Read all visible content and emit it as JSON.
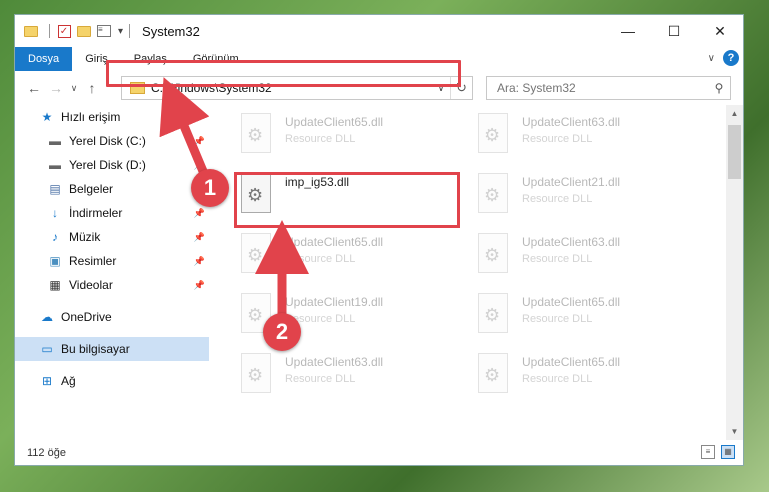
{
  "window": {
    "title": "System32",
    "controls": {
      "minimize": "—",
      "maximize": "☐",
      "close": "✕"
    }
  },
  "ribbon": {
    "tabs": [
      {
        "label": "Dosya",
        "active": true
      },
      {
        "label": "Giriş"
      },
      {
        "label": "Paylaş"
      },
      {
        "label": "Görünüm"
      }
    ],
    "help": "?"
  },
  "address": {
    "path": "C:\\Windows\\System32",
    "search_placeholder": "Ara: System32"
  },
  "sidebar": {
    "items": [
      {
        "label": "Hızlı erişim",
        "icon": "star-icon"
      },
      {
        "label": "Yerel Disk (C:)",
        "icon": "drive-icon",
        "pinned": true
      },
      {
        "label": "Yerel Disk (D:)",
        "icon": "drive-icon",
        "pinned": true
      },
      {
        "label": "Belgeler",
        "icon": "documents-icon",
        "pinned": true
      },
      {
        "label": "İndirmeler",
        "icon": "download-icon",
        "pinned": true
      },
      {
        "label": "Müzik",
        "icon": "music-icon",
        "pinned": true
      },
      {
        "label": "Resimler",
        "icon": "pictures-icon",
        "pinned": true
      },
      {
        "label": "Videolar",
        "icon": "videos-icon",
        "pinned": true
      },
      {
        "label": "OneDrive",
        "icon": "cloud-icon"
      },
      {
        "label": "Bu bilgisayar",
        "icon": "computer-icon",
        "selected": true
      },
      {
        "label": "Ağ",
        "icon": "network-icon"
      }
    ]
  },
  "files": [
    {
      "name": "UpdateClient65.dll",
      "type": "Resource DLL",
      "faded": true
    },
    {
      "name": "UpdateClient63.dll",
      "type": "Resource DLL",
      "faded": true
    },
    {
      "name": "imp_ig53.dll",
      "type": "",
      "faded": false
    },
    {
      "name": "UpdateClient21.dll",
      "type": "Resource DLL",
      "faded": true
    },
    {
      "name": "UpdateClient65.dll",
      "type": "Resource DLL",
      "faded": true
    },
    {
      "name": "UpdateClient63.dll",
      "type": "Resource DLL",
      "faded": true
    },
    {
      "name": "UpdateClient19.dll",
      "type": "Resource DLL",
      "faded": true
    },
    {
      "name": "UpdateClient65.dll",
      "type": "Resource DLL",
      "faded": true
    },
    {
      "name": "UpdateClient63.dll",
      "type": "Resource DLL",
      "faded": true
    },
    {
      "name": "UpdateClient65.dll",
      "type": "Resource DLL",
      "faded": true
    }
  ],
  "status": {
    "count": "112 öğe"
  },
  "annotations": {
    "step1": "1",
    "step2": "2",
    "color": "#e1434b"
  }
}
